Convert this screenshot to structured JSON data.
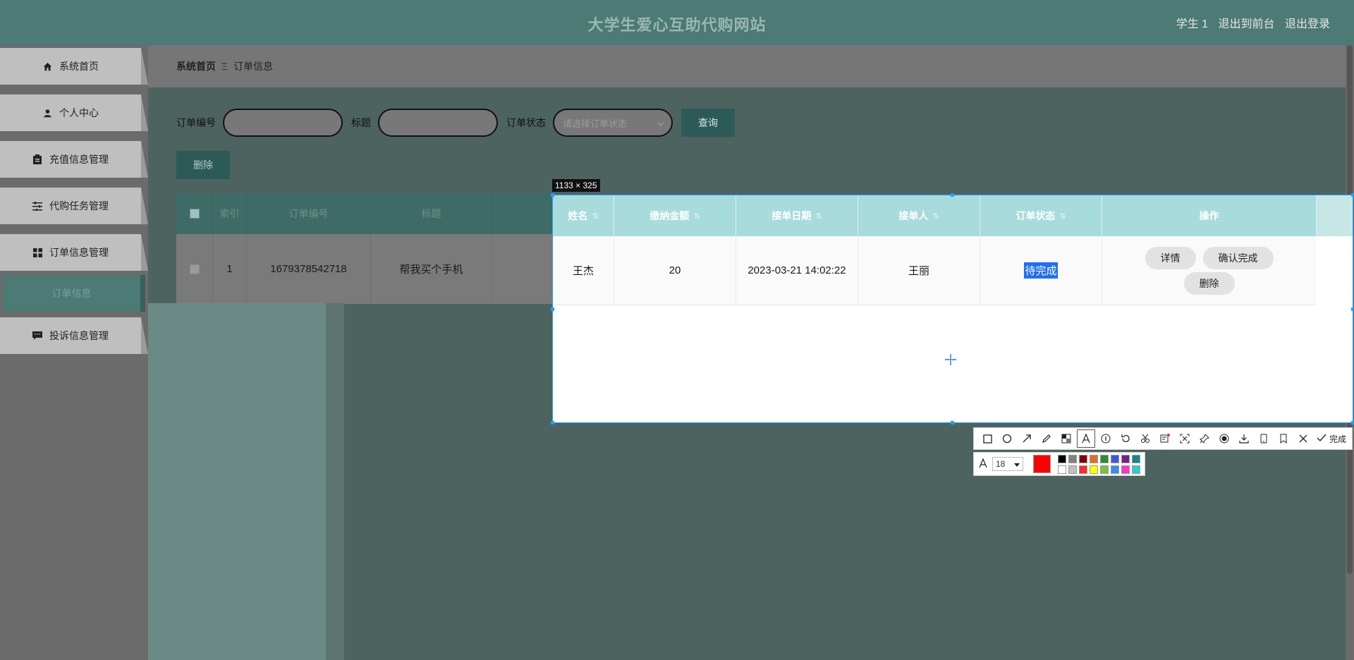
{
  "header": {
    "title": "大学生爱心互助代购网站",
    "user": "学生 1",
    "back_to_front": "退出到前台",
    "logout": "退出登录"
  },
  "sidebar": {
    "items": [
      {
        "label": "系统首页",
        "icon": "home-icon"
      },
      {
        "label": "个人中心",
        "icon": "user-icon"
      },
      {
        "label": "充值信息管理",
        "icon": "clipboard-icon"
      },
      {
        "label": "代购任务管理",
        "icon": "sliders-icon"
      },
      {
        "label": "订单信息管理",
        "icon": "grid-icon"
      },
      {
        "label": "投诉信息管理",
        "icon": "comment-icon"
      }
    ],
    "submenu_active": "订单信息"
  },
  "breadcrumb": {
    "home": "系统首页",
    "sep": "Ξ",
    "current": "订单信息"
  },
  "filter": {
    "order_no_label": "订单编号",
    "order_no_placeholder": "订单编号",
    "title_label": "标题",
    "title_placeholder": "标题",
    "status_label": "订单状态",
    "status_placeholder": "请选择订单状态",
    "query_button": "查询"
  },
  "actions": {
    "delete": "删除"
  },
  "table": {
    "columns": [
      "索引",
      "订单编号",
      "标题",
      "姓名",
      "缴纳金额",
      "接单日期",
      "接单人",
      "订单状态",
      "操作"
    ],
    "rows": [
      {
        "index": "1",
        "order_no": "1679378542718",
        "title": "帮我买个手机",
        "name": "王杰",
        "amount": "20",
        "date": "2023-03-21 14:02:22",
        "taker": "王丽",
        "status": "待完成",
        "ops": {
          "detail": "详情",
          "confirm": "确认完成",
          "delete": "删除"
        }
      }
    ]
  },
  "capture": {
    "size_label": "1133 × 325"
  },
  "annotation_toolbar": {
    "done_label": "完成",
    "font_size": "18",
    "current_color": "#ff0000",
    "palette": [
      "#000000",
      "#808080",
      "#800000",
      "#e46c2b",
      "#2e8b2e",
      "#3b5bd6",
      "#7a1f8a",
      "#138a8a",
      "#ffffff",
      "#c0c0c0",
      "#ff2a2a",
      "#ffff00",
      "#7ac143",
      "#3a8ee6",
      "#ff33cc",
      "#33cccc"
    ]
  }
}
